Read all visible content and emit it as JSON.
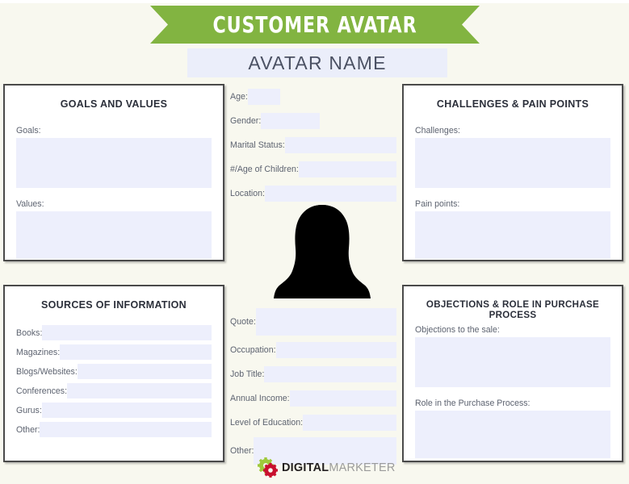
{
  "banner": {
    "title": "CUSTOMER AVATAR",
    "color": "#82b441"
  },
  "avatar_name": {
    "label": "AVATAR NAME"
  },
  "colors": {
    "background": "#f8f8ef",
    "field_fill": "#edeffc",
    "panel_border": "#4a4a4a",
    "accent_green": "#82b441",
    "accent_red": "#c8102e",
    "text_dark": "#2b2f3a",
    "text_label": "#5d6370"
  },
  "panels": {
    "goals_and_values": {
      "title": "GOALS AND VALUES",
      "fields": [
        {
          "label": "Goals:",
          "value": ""
        },
        {
          "label": "Values:",
          "value": ""
        }
      ]
    },
    "challenges_and_pain_points": {
      "title": "CHALLENGES & PAIN POINTS",
      "fields": [
        {
          "label": "Challenges:",
          "value": ""
        },
        {
          "label": "Pain points:",
          "value": ""
        }
      ]
    },
    "sources_of_information": {
      "title": "SOURCES OF INFORMATION",
      "fields": [
        {
          "label": "Books:",
          "value": ""
        },
        {
          "label": "Magazines:",
          "value": ""
        },
        {
          "label": "Blogs/Websites:",
          "value": ""
        },
        {
          "label": "Conferences:",
          "value": ""
        },
        {
          "label": "Gurus:",
          "value": ""
        },
        {
          "label": "Other:",
          "value": ""
        }
      ]
    },
    "objections_and_role": {
      "title": "OBJECTIONS & ROLE IN PURCHASE PROCESS",
      "fields": [
        {
          "label": "Objections to the sale:",
          "value": ""
        },
        {
          "label": "Role in the Purchase Process:",
          "value": ""
        }
      ]
    }
  },
  "demographics": {
    "fields": [
      {
        "label": "Age:",
        "value": ""
      },
      {
        "label": "Gender:",
        "value": ""
      },
      {
        "label": "Marital Status:",
        "value": ""
      },
      {
        "label": "#/Age of Children:",
        "value": ""
      },
      {
        "label": "Location:",
        "value": ""
      }
    ]
  },
  "profile": {
    "fields": [
      {
        "label": "Quote:",
        "value": ""
      },
      {
        "label": "Occupation:",
        "value": ""
      },
      {
        "label": "Job Title:",
        "value": ""
      },
      {
        "label": "Annual Income:",
        "value": ""
      },
      {
        "label": "Level of Education:",
        "value": ""
      },
      {
        "label": "Other:",
        "value": ""
      }
    ]
  },
  "avatar_image": {
    "icon": "person-silhouette-icon",
    "color": "#000000"
  },
  "logo": {
    "icon": "gears-icon",
    "primary": "DIGITAL",
    "secondary": "MARKETER"
  }
}
